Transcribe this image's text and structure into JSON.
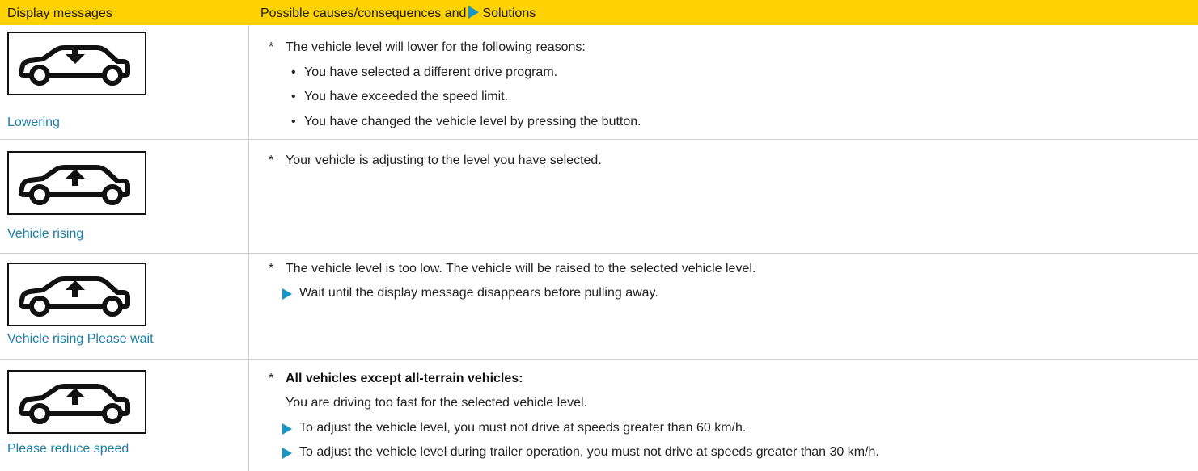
{
  "header": {
    "col1": "Display messages",
    "col2_prefix": "Possible causes/consequences and",
    "col2_suffix": "Solutions"
  },
  "rows": [
    {
      "icon": "car-lowering-icon",
      "caption": "Lowering",
      "lines": [
        {
          "kind": "star",
          "text": "The vehicle level will lower for the following reasons:"
        },
        {
          "kind": "bullet",
          "text": "You have selected a different drive program."
        },
        {
          "kind": "bullet",
          "text": "You have exceeded the speed limit."
        },
        {
          "kind": "bullet",
          "text": "You have changed the vehicle level by pressing the button."
        }
      ]
    },
    {
      "icon": "car-rising-icon",
      "caption": "Vehicle rising",
      "lines": [
        {
          "kind": "star",
          "text": "Your vehicle is adjusting to the level you have selected."
        }
      ]
    },
    {
      "icon": "car-rising-icon",
      "caption": "Vehicle rising Please wait",
      "lines": [
        {
          "kind": "star",
          "text": "The vehicle level is too low. The vehicle will be raised to the selected vehicle level."
        },
        {
          "kind": "solution",
          "text": "Wait until the display message disappears before pulling away."
        }
      ]
    },
    {
      "icon": "car-rising-icon",
      "caption": "Please reduce speed",
      "lines": [
        {
          "kind": "star-bold",
          "text": "All vehicles except all-terrain vehicles:"
        },
        {
          "kind": "plain",
          "text": "You are driving too fast for the selected vehicle level."
        },
        {
          "kind": "solution",
          "text": "To adjust the vehicle level, you must not drive at speeds greater than 60 km/h."
        },
        {
          "kind": "solution",
          "text": "To adjust the vehicle level during trailer operation, you must not drive at speeds greater than 30 km/h."
        }
      ]
    }
  ],
  "colors": {
    "header_bg": "#ffd200",
    "caption": "#1b7fa6",
    "solution_arrow": "#1796c8"
  }
}
